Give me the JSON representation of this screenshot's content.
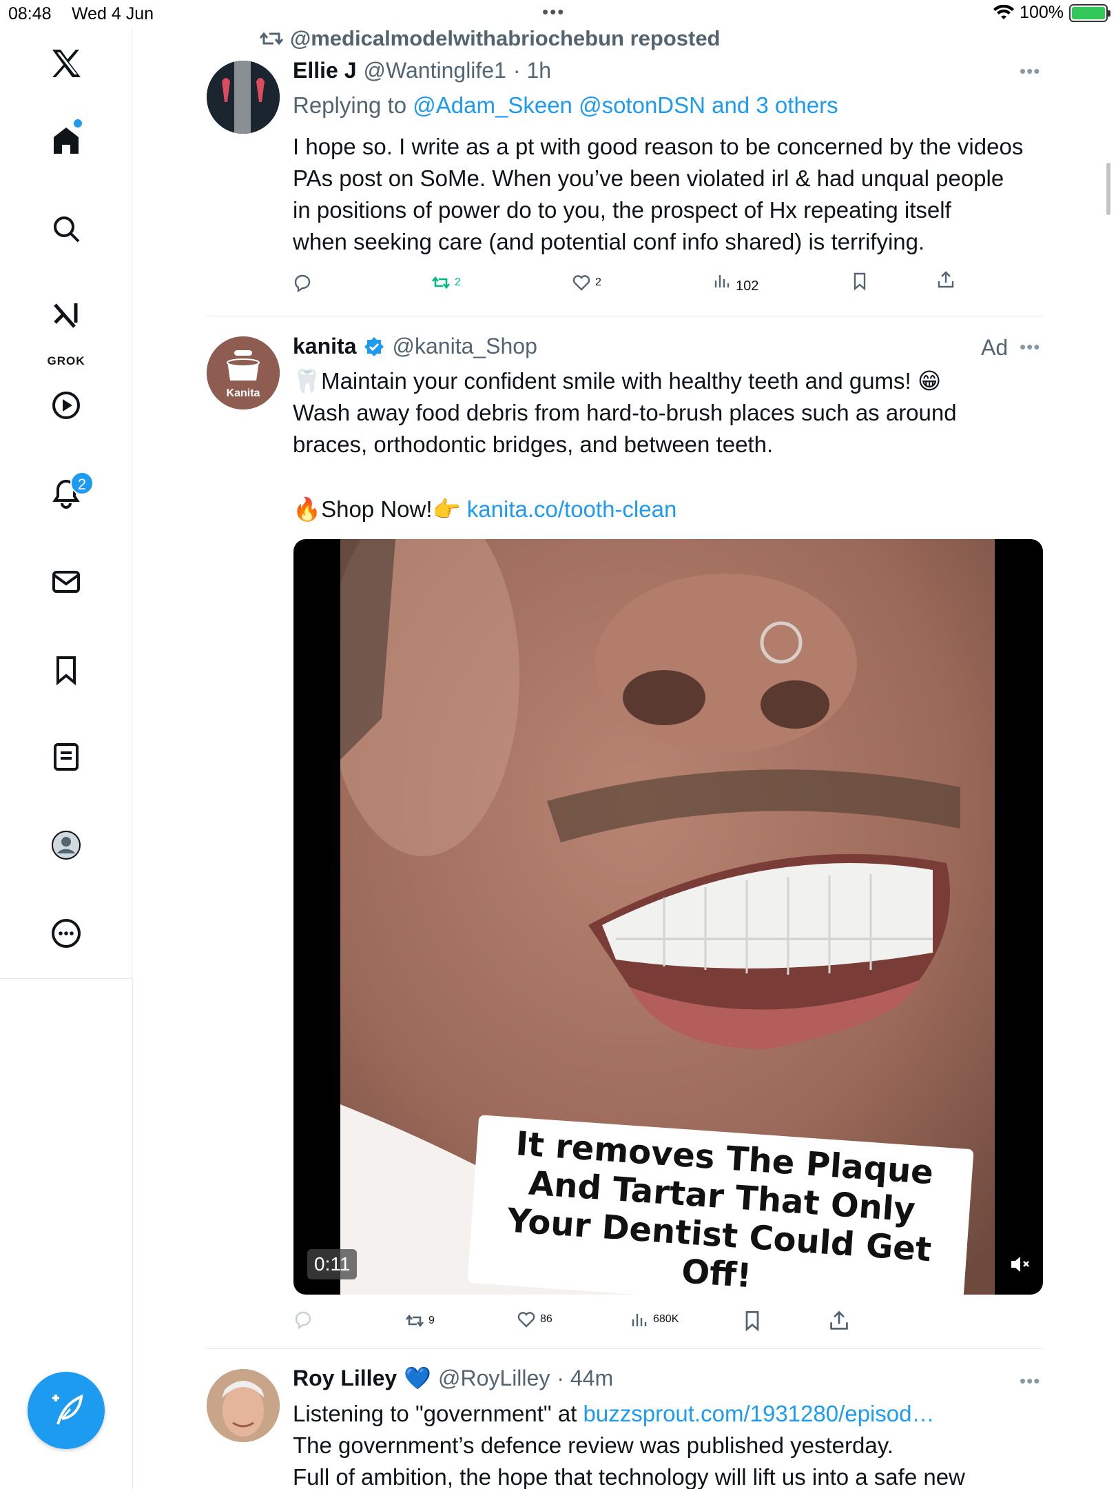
{
  "status_bar": {
    "time": "08:48",
    "date": "Wed 4 Jun",
    "multitask": "•••",
    "battery": "100%"
  },
  "nav": {
    "items": [
      "x-logo",
      "home",
      "search",
      "grok",
      "videos",
      "notifications",
      "messages",
      "bookmarks",
      "lists",
      "profile",
      "more"
    ],
    "grok_label": "GROK",
    "notifications_badge": "2"
  },
  "tweets": [
    {
      "repost_text": "@medicalmodelwithabriochebun reposted",
      "name": "Ellie J",
      "handle": "@Wantinglife1",
      "time": "· 1h",
      "replying_prefix": "Replying to",
      "replying_to": "@Adam_Skeen @sotonDSN and 3 others",
      "text_lines": [
        "I hope so. I write as a pt with good reason to be concerned by the videos",
        "PAs post on SoMe. When you’ve been violated irl & had unqual people",
        "in positions of power do to you, the prospect of Hx repeating itself",
        "when seeking care (and potential conf info shared) is terrifying."
      ],
      "reposts": "2",
      "likes": "2",
      "views": "102"
    },
    {
      "name": "kanita",
      "handle": "@kanita_Shop",
      "ad_label": "Ad",
      "avatar_text": "Kanita",
      "text_line1": "🦷Maintain your confident smile with healthy teeth and gums! 😁",
      "text_line2": "Wash away food debris from hard-to-brush places such as around",
      "text_line3": "braces, orthodontic bridges, and between teeth.",
      "shop_text": "🔥Shop Now!👉",
      "shop_link": "kanita.co/tooth-clean",
      "video_caption": "It removes The Plaque And Tartar That Only Your Dentist Could Get Off!",
      "video_time": "0:11",
      "reposts": "9",
      "likes": "86",
      "views": "680K"
    },
    {
      "name": "Roy Lilley",
      "badge": "💙",
      "handle": "@RoyLilley",
      "time": "· 44m",
      "line1_prefix": "Listening to \"government\" at",
      "line1_link": "buzzsprout.com/1931280/episod…",
      "line2": "The government’s defence review was published yesterday.",
      "line3": "Full of ambition, the hope that technology will lift us into a safe new"
    }
  ],
  "colors": {
    "accent": "#1d9bf0",
    "muted": "#536471",
    "repost_green": "#00ba7c",
    "divider": "#e4e7ea"
  }
}
